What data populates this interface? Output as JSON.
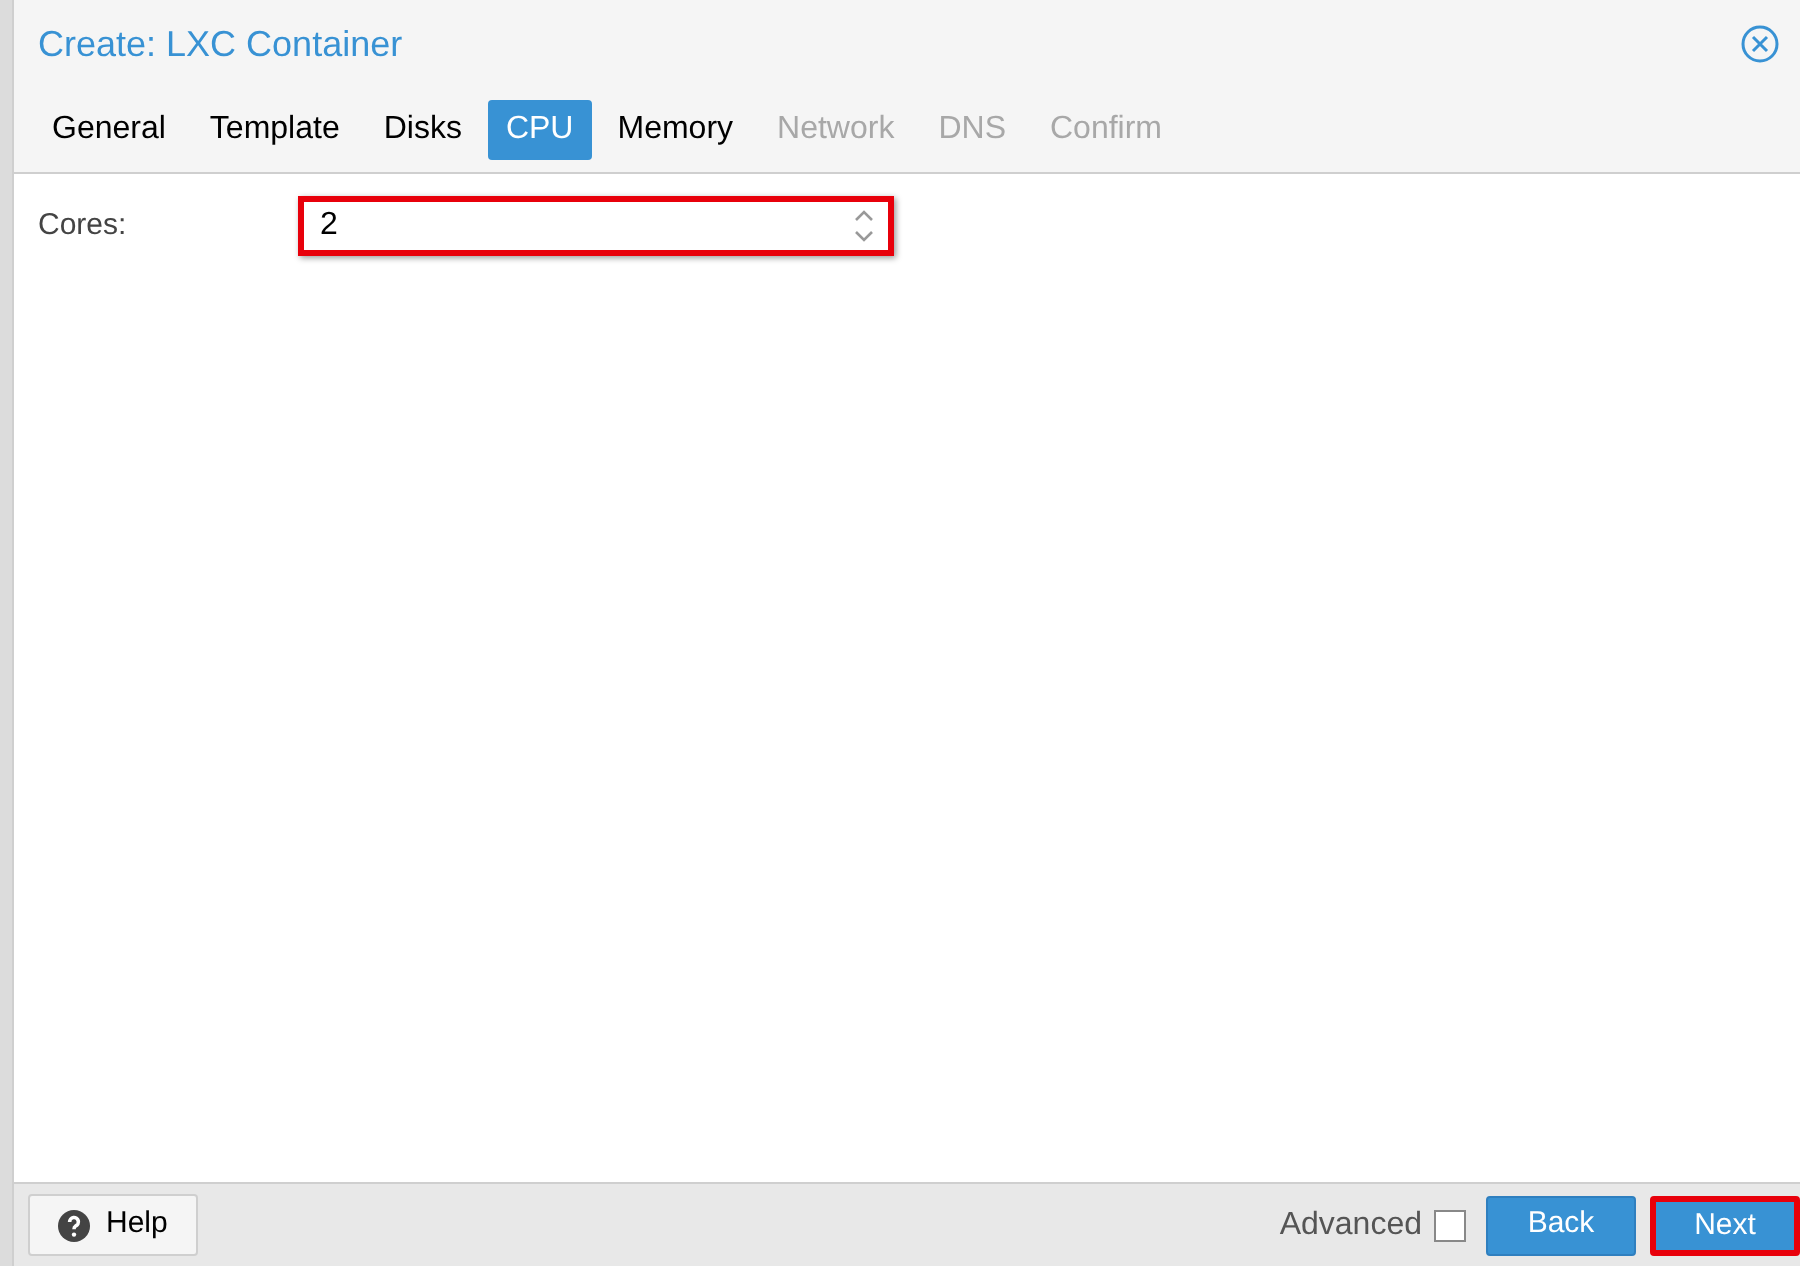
{
  "window": {
    "title": "Create: LXC Container"
  },
  "tabs": [
    {
      "label": "General",
      "selected": false,
      "disabled": false
    },
    {
      "label": "Template",
      "selected": false,
      "disabled": false
    },
    {
      "label": "Disks",
      "selected": false,
      "disabled": false
    },
    {
      "label": "CPU",
      "selected": true,
      "disabled": false
    },
    {
      "label": "Memory",
      "selected": false,
      "disabled": false
    },
    {
      "label": "Network",
      "selected": false,
      "disabled": true
    },
    {
      "label": "DNS",
      "selected": false,
      "disabled": true
    },
    {
      "label": "Confirm",
      "selected": false,
      "disabled": true
    }
  ],
  "fields": [
    {
      "label": "Cores:",
      "value": "2",
      "highlighted": true
    }
  ],
  "footer": {
    "help": "Help",
    "advanced": {
      "label": "Advanced",
      "checked": false
    },
    "buttons": [
      {
        "label": "Back",
        "highlighted": false
      },
      {
        "label": "Next",
        "highlighted": true
      }
    ]
  }
}
